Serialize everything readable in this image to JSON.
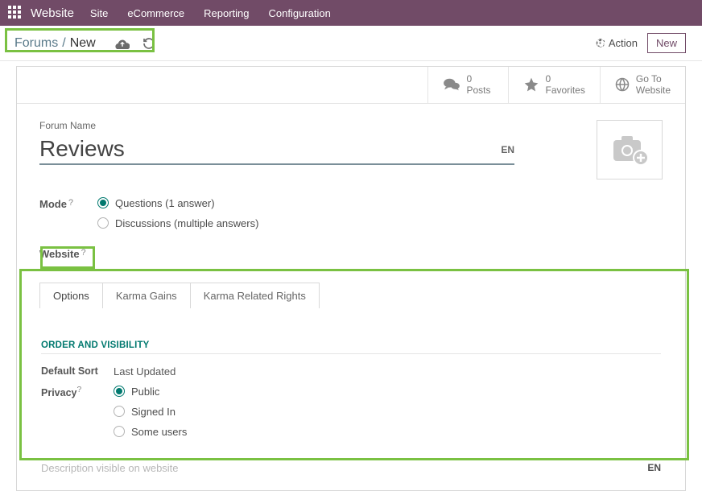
{
  "topbar": {
    "brand": "Website",
    "menu": [
      "Site",
      "eCommerce",
      "Reporting",
      "Configuration"
    ]
  },
  "crumbs": {
    "root": "Forums",
    "current": "New"
  },
  "actions": {
    "action": "Action",
    "new": "New"
  },
  "stats": {
    "posts": {
      "count": "0",
      "label": "Posts"
    },
    "favorites": {
      "count": "0",
      "label": "Favorites"
    },
    "goto": {
      "line1": "Go To",
      "line2": "Website"
    }
  },
  "form": {
    "name_label": "Forum Name",
    "name_value": "Reviews",
    "lang": "EN",
    "mode_label": "Mode",
    "mode_q": "Questions (1 answer)",
    "mode_d": "Discussions (multiple answers)",
    "website_label": "Website"
  },
  "tabs": [
    "Options",
    "Karma Gains",
    "Karma Related Rights"
  ],
  "options": {
    "section_title": "ORDER AND VISIBILITY",
    "default_sort_label": "Default Sort",
    "default_sort_value": "Last Updated",
    "privacy_label": "Privacy",
    "privacy_public": "Public",
    "privacy_signed": "Signed In",
    "privacy_some": "Some users",
    "desc_placeholder": "Description visible on website",
    "lang": "EN"
  }
}
